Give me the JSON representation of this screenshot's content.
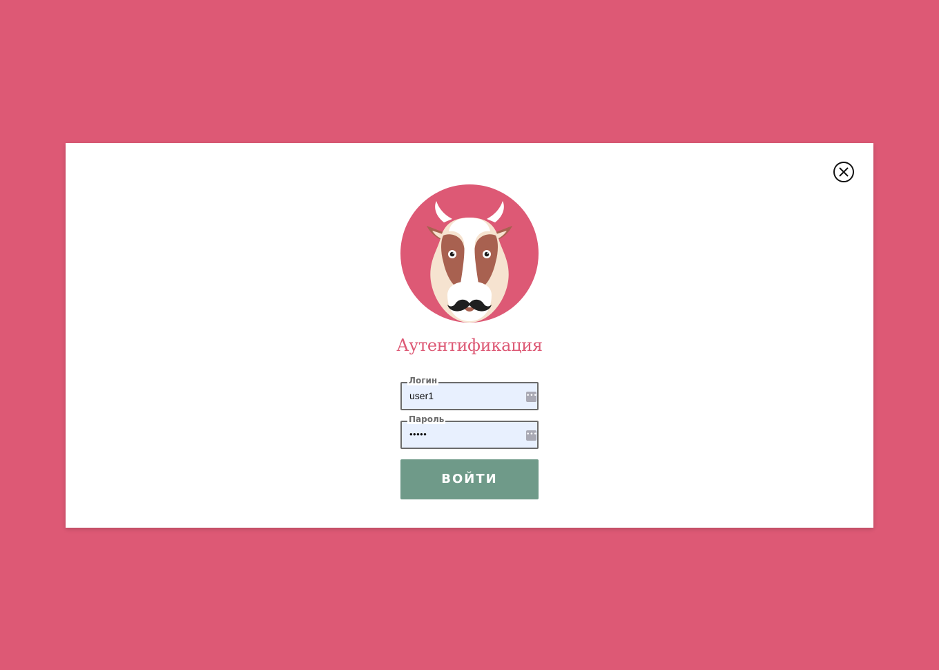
{
  "colors": {
    "background": "#dd5975",
    "accent": "#dd5975",
    "button": "#6f9a89",
    "input_fill": "#e8f0fe"
  },
  "modal": {
    "close_icon": "close-circle-icon",
    "logo_icon": "cow-mustache-logo",
    "title": "Аутентификация",
    "login": {
      "label": "Логин",
      "value": "user1",
      "autofill_icon": "dots-icon"
    },
    "password": {
      "label": "Пароль",
      "value": "•••••",
      "autofill_icon": "dots-icon"
    },
    "submit_label": "ВОЙТИ"
  }
}
